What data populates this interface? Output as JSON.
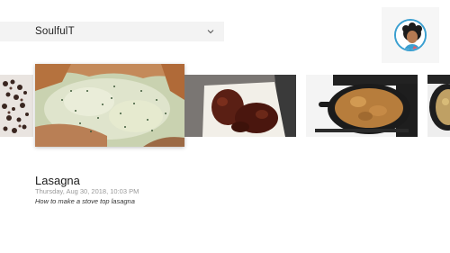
{
  "account": {
    "name": "SoulfulT"
  },
  "video": {
    "title": "Lasagna",
    "date": "Thursday, Aug 30, 2018, 10:03 PM",
    "description": "How to make a stove top lasagna"
  },
  "thumbnails": [
    {
      "name": "thumbnail-dark-crumble"
    },
    {
      "name": "thumbnail-lasagna-cheese"
    },
    {
      "name": "thumbnail-meat-on-paper"
    },
    {
      "name": "thumbnail-skillet-pasta"
    },
    {
      "name": "thumbnail-pan-partial"
    }
  ],
  "colors": {
    "background": "#ffffff",
    "account_bar": "#f3f3f3",
    "avatar_ring": "#3a9fd0"
  }
}
